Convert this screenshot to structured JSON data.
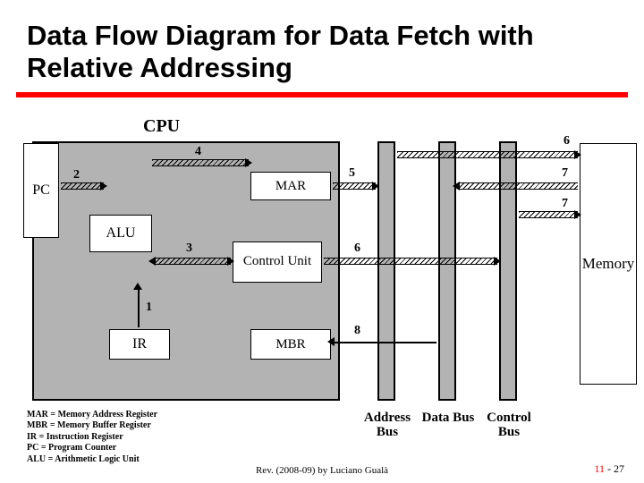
{
  "title": "Data Flow Diagram for Data Fetch with Relative Addressing",
  "cpu_label": "CPU",
  "components": {
    "pc": "PC",
    "mar": "MAR",
    "alu": "ALU",
    "ctrl": "Control Unit",
    "ir": "IR",
    "mbr": "MBR",
    "memory": "Memory"
  },
  "buses": {
    "address": "Address Bus",
    "data": "Data Bus",
    "control": "Control Bus"
  },
  "steps": {
    "s1": "1",
    "s2": "2",
    "s3": "3",
    "s4": "4",
    "s5": "5",
    "s6a": "6",
    "s6b": "6",
    "s7a": "7",
    "s7b": "7",
    "s8": "8"
  },
  "legend": {
    "l1": "MAR = Memory Address Register",
    "l2": "MBR = Memory Buffer Register",
    "l3": "IR = Instruction Register",
    "l4": "PC = Program Counter",
    "l5": "ALU = Arithmetic Logic Unit"
  },
  "attribution": "Rev. (2008-09) by Luciano Gualà",
  "page": {
    "chapter": "11",
    "sep": "-",
    "num": "27"
  }
}
